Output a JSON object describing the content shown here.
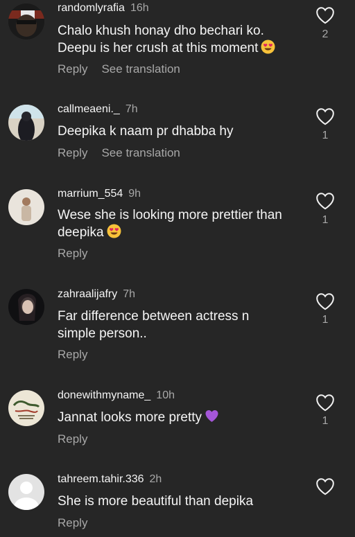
{
  "actions": {
    "reply": "Reply",
    "see_translation": "See translation"
  },
  "icons": {
    "like": "heart-outline-icon"
  },
  "comments": [
    {
      "username": "randomlyrafia",
      "time": "16h",
      "text_lines": [
        "Chalo khush honay dho bechari ko.",
        "Deepu is her crush at this moment"
      ],
      "emoji": "heart-eyes-emoji",
      "likes": "2",
      "translation": true
    },
    {
      "username": "callmeaeni._",
      "time": "7h",
      "text_lines": [
        "Deepika k naam pr dhabba hy"
      ],
      "likes": "1",
      "translation": true
    },
    {
      "username": "marrium_554",
      "time": "9h",
      "text_lines": [
        "Wese she is looking more prettier than",
        "deepika"
      ],
      "emoji": "heart-eyes-emoji",
      "likes": "1",
      "translation": false
    },
    {
      "username": "zahraalijafry",
      "time": "7h",
      "text_lines": [
        "Far difference between actress n",
        "simple person.."
      ],
      "likes": "1",
      "translation": false
    },
    {
      "username": "donewithmyname_",
      "time": "10h",
      "text_lines": [
        "Jannat looks more pretty"
      ],
      "emoji": "purple-heart-emoji",
      "likes": "1",
      "translation": false
    },
    {
      "username": "tahreem.tahir.336",
      "time": "2h",
      "text_lines": [
        "She is more beautiful than depika"
      ],
      "likes": "",
      "translation": false
    }
  ]
}
